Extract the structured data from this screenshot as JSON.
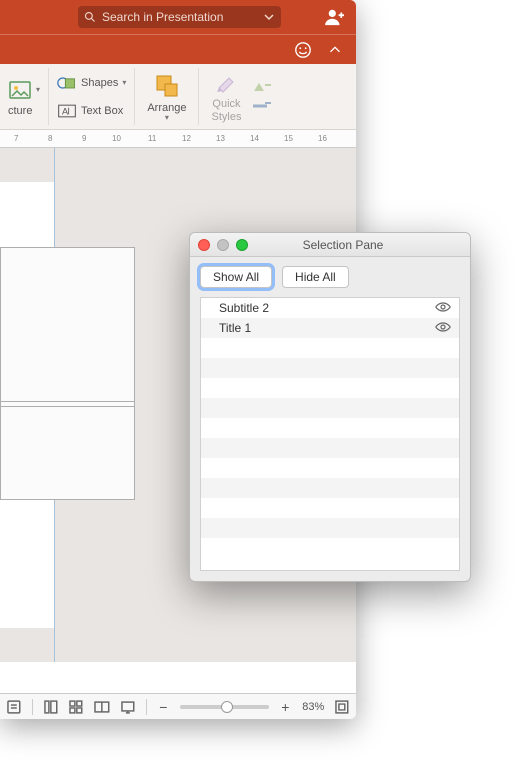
{
  "titlebar": {
    "search_placeholder": "Search in Presentation"
  },
  "ribbon": {
    "picture_label": "cture",
    "shapes_label": "Shapes",
    "textbox_label": "Text Box",
    "arrange_label": "Arrange",
    "quickstyles_label": "Quick\nStyles"
  },
  "ruler": {
    "n7": "7",
    "n8": "8",
    "n9": "9",
    "n10": "10",
    "n11": "11",
    "n12": "12",
    "n13": "13",
    "n14": "14",
    "n15": "15",
    "n16": "16"
  },
  "statusbar": {
    "zoom": "83%"
  },
  "selection_pane": {
    "title": "Selection Pane",
    "show_all": "Show All",
    "hide_all": "Hide All",
    "items": [
      {
        "label": "Subtitle 2"
      },
      {
        "label": "Title 1"
      }
    ]
  }
}
